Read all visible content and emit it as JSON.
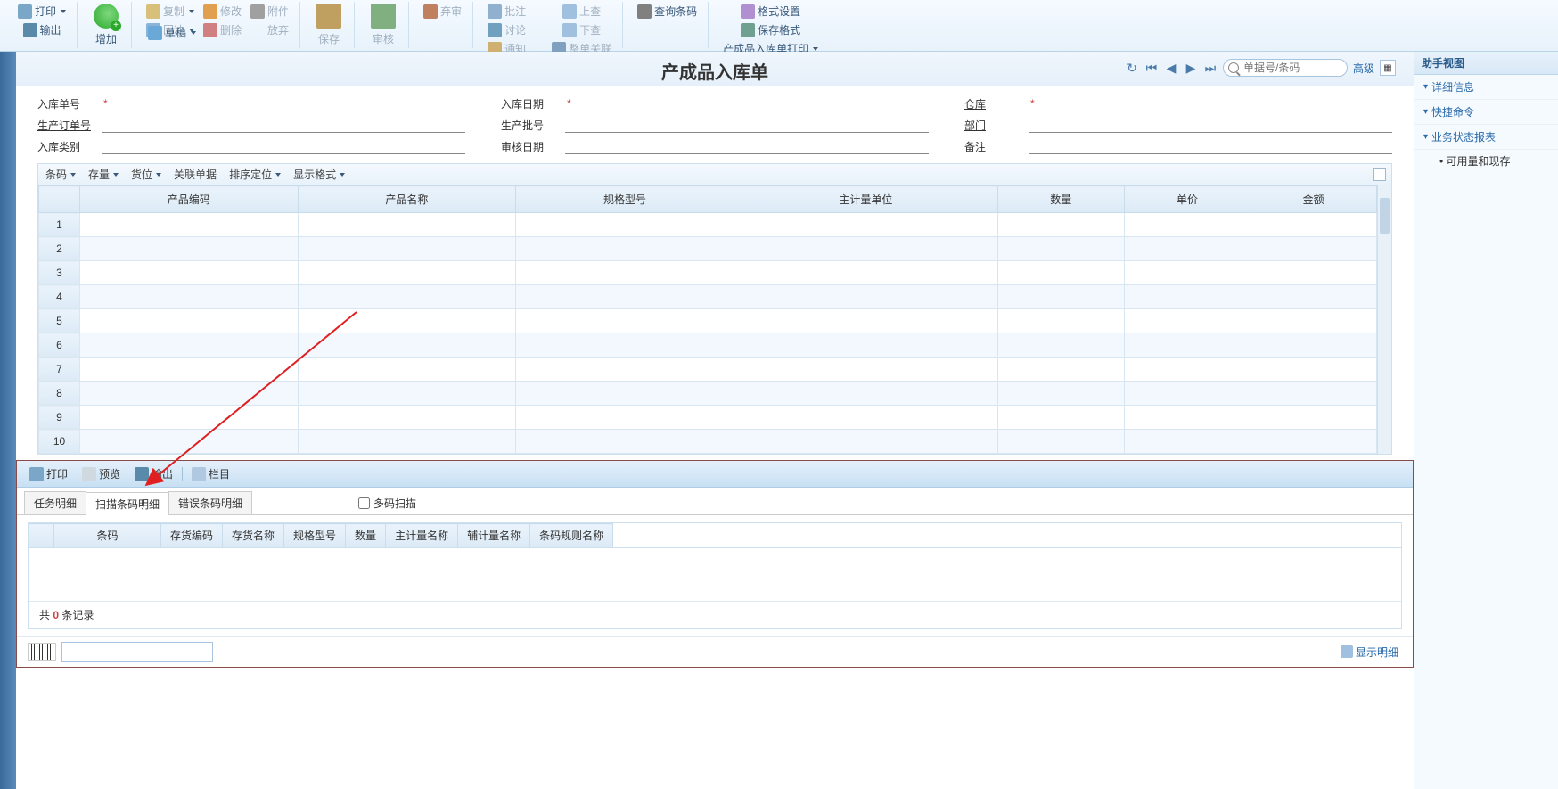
{
  "ribbon": {
    "print": "打印",
    "export": "输出",
    "add": "增加",
    "copy": "复制",
    "undo": "回冲",
    "draft": "草稿",
    "modify": "修改",
    "delete": "删除",
    "attach": "附件",
    "release": "放弃",
    "save": "保存",
    "audit": "审核",
    "reject": "弃审",
    "batch": "批注",
    "discuss": "讨论",
    "notify": "通知",
    "topage": "上查",
    "downpage": "下查",
    "link": "整单关联",
    "barcode": "查询条码",
    "format": "格式设置",
    "saveformat": "保存格式",
    "printdoc": "产成品入库单打印"
  },
  "doc": {
    "title": "产成品入库单",
    "search_placeholder": "单据号/条码",
    "advanced": "高级"
  },
  "form": {
    "doc_no": "入库单号",
    "doc_date": "入库日期",
    "warehouse": "仓库",
    "prod_order": "生产订单号",
    "batch": "生产批号",
    "dept": "部门",
    "in_type": "入库类别",
    "audit_date": "审核日期",
    "remark": "备注"
  },
  "gridToolbar": {
    "barcode": "条码",
    "stock": "存量",
    "loc": "货位",
    "relbill": "关联单据",
    "sort": "排序定位",
    "dispfmt": "显示格式"
  },
  "gridCols": [
    "产品编码",
    "产品名称",
    "规格型号",
    "主计量单位",
    "数量",
    "单价",
    "金额"
  ],
  "gridRows": [
    1,
    2,
    3,
    4,
    5,
    6,
    7,
    8,
    9,
    10
  ],
  "bottomToolbar": {
    "print": "打印",
    "preview": "预览",
    "export": "输出",
    "columns": "栏目"
  },
  "bottomTabs": [
    "任务明细",
    "扫描条码明细",
    "错误条码明细"
  ],
  "multiScan": "多码扫描",
  "bottomCols": [
    "条码",
    "存货编码",
    "存货名称",
    "规格型号",
    "数量",
    "主计量名称",
    "辅计量名称",
    "条码规则名称"
  ],
  "recordPrefix": "共",
  "recordCount": "0",
  "recordSuffix": "条记录",
  "showDetail": "显示明细",
  "rightPanel": {
    "title": "助手视图",
    "detail": "详细信息",
    "quick": "快捷命令",
    "report": "业务状态报表",
    "avail": "可用量和现存"
  }
}
